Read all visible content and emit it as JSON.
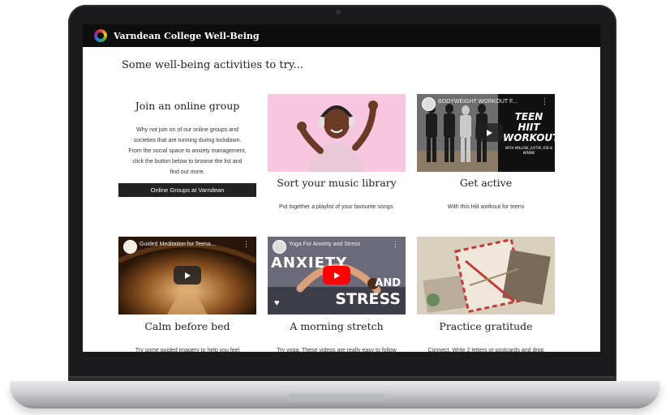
{
  "site": {
    "title": "Varndean College Well-Being"
  },
  "page": {
    "heading": "Some well-being activities to try..."
  },
  "group": {
    "title": "Join an online group",
    "text_lines": [
      "Why not join on of our online groups and",
      "societies that are running during lockdown.",
      "From the social space to anxiety management,",
      "click the button below to browse the list and",
      "find out more."
    ],
    "button_label": "Online Groups at Varndean"
  },
  "cards": [
    {
      "title": "Sort your music library",
      "text": "Put together a playlist of your favourite songs."
    },
    {
      "title": "Get active",
      "text": "With this Hiit workout for teens",
      "video_title": "BODYWEIGHT WORKOUT F...",
      "overlay_lines": [
        "TEEN",
        "HIIT",
        "WORKOUT"
      ],
      "overlay_small": "WITH WILLOW, JUSTIN, ION & WINNIE"
    },
    {
      "title": "Calm before bed",
      "text": "Try some guided imagery to help you feel",
      "video_title": "Guided Meditation for Teena..."
    },
    {
      "title": "A morning stretch",
      "text": "Try yoga. These videos are really easy to follow",
      "video_title": "Yoga For Anxiety and Stress",
      "overlay_words": [
        "ANXIETY",
        "AND",
        "STRESS"
      ]
    },
    {
      "title": "Practice gratitude",
      "text": "Connect. Write 2 letters or postcards and drop"
    }
  ],
  "colors": {
    "topbar": "#0d0d0d",
    "button": "#222222",
    "youtube_red": "#ff0000"
  }
}
